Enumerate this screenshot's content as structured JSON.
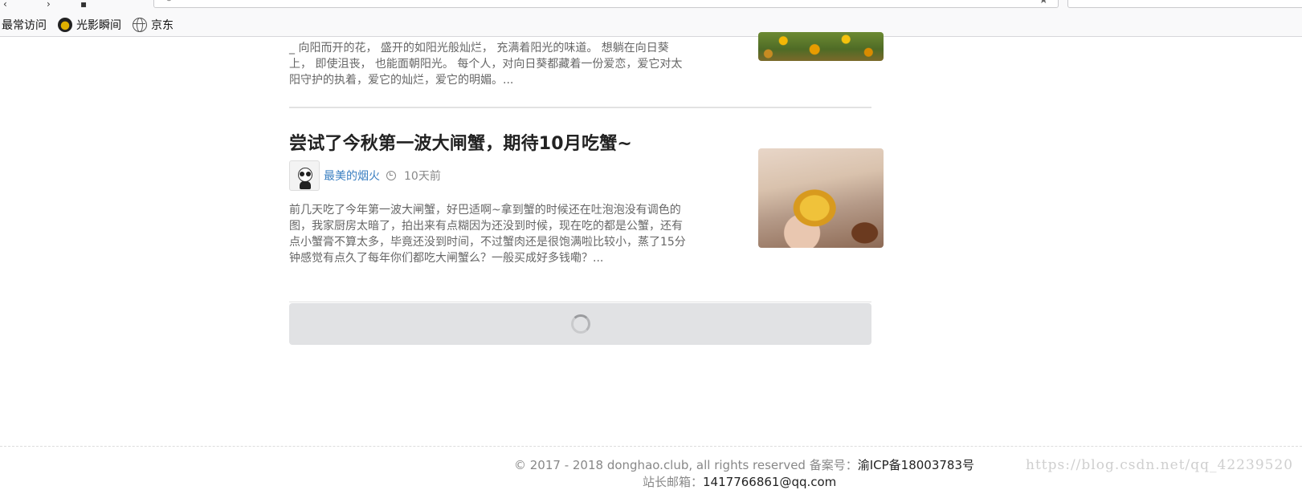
{
  "browser": {
    "bookmarks": [
      {
        "label": "最常访问",
        "icon": "none"
      },
      {
        "label": "光影瞬间",
        "icon": "photo-icon"
      },
      {
        "label": "京东",
        "icon": "globe-icon"
      }
    ]
  },
  "articles": [
    {
      "excerpt": "_ 向阳而开的花， 盛开的如阳光般灿烂， 充满着阳光的味道。 想躺在向日葵上， 即使沮丧， 也能面朝阳光。 每个人，对向日葵都藏着一份爱恋，爱它对太阳守护的执着，爱它的灿烂，爱它的明媚。..."
    },
    {
      "title": "尝试了今秋第一波大闸蟹，期待10月吃蟹~",
      "author": "最美的烟火",
      "time": "10天前",
      "excerpt": "前几天吃了今年第一波大闸蟹，好巴适啊~拿到蟹的时候还在吐泡泡没有调色的图，我家厨房太暗了，拍出来有点糊因为还没到时候，现在吃的都是公蟹，还有点小蟹膏不算太多，毕竟还没到时间，不过蟹肉还是很饱满啦比较小，蒸了15分钟感觉有点久了每年你们都吃大闸蟹么？一般买成好多钱嘞？..."
    }
  ],
  "footer": {
    "copyright": "© 2017 - 2018 donghao.club, all rights reserved 备案号：",
    "icp": "渝ICP备18003783号",
    "email_label": "站长邮箱：",
    "email": "1417766861@qq.com"
  },
  "watermark": "https://blog.csdn.net/qq_42239520",
  "colors": {
    "link": "#3a7fc1",
    "loader_bg": "#e1e2e4"
  }
}
